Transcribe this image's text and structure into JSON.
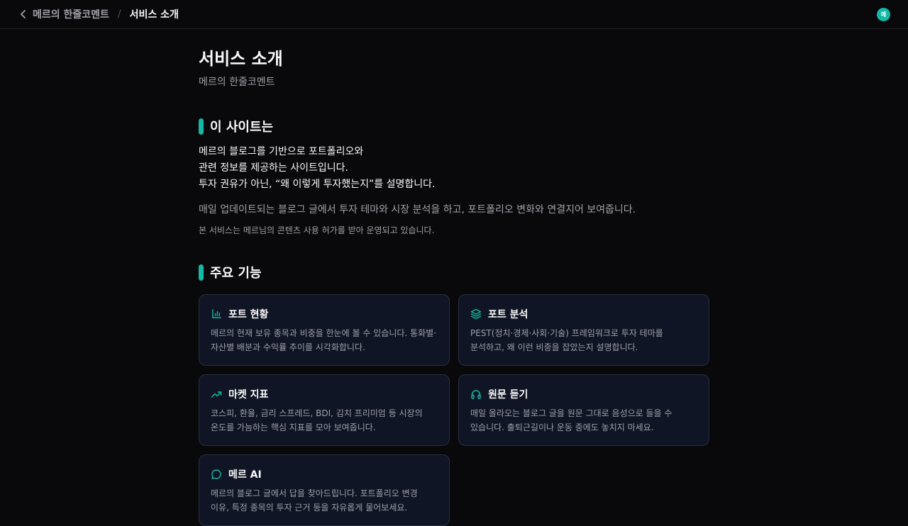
{
  "header": {
    "breadcrumb_parent": "메르의 한줄코멘트",
    "breadcrumb_separator": "/",
    "breadcrumb_current": "서비스 소개",
    "avatar_text": "메"
  },
  "page": {
    "title": "서비스 소개",
    "subtitle": "메르의 한줄코멘트"
  },
  "about": {
    "heading": "이 사이트는",
    "lines": [
      "메르의 블로그를 기반으로 포트폴리오와",
      "관련 정보를 제공하는 사이트입니다.",
      "투자 권유가 아닌, “왜 이렇게 투자했는지”를 설명합니다."
    ],
    "description": "매일 업데이트되는 블로그 글에서 투자 테마와 시장 분석을 하고, 포트폴리오 변화와 연결지어 보여줍니다.",
    "note": "본 서비스는 메르님의 콘텐츠 사용 허가를 받아 운영되고 있습니다."
  },
  "features": {
    "heading": "주요 기능",
    "items": [
      {
        "icon": "bar-chart-icon",
        "title": "포트 현황",
        "desc": "메르의 현재 보유 종목과 비중을 한눈에 볼 수 있습니다. 통화별·자산별 배분과 수익률 추이를 시각화합니다."
      },
      {
        "icon": "layers-icon",
        "title": "포트 분석",
        "desc": "PEST(정치·경제·사회·기술) 프레임워크로 투자 테마를 분석하고, 왜 이런 비중을 잡았는지 설명합니다."
      },
      {
        "icon": "trending-up-icon",
        "title": "마켓 지표",
        "desc": "코스피, 환율, 금리 스프레드, BDI, 김치 프리미엄 등 시장의 온도를 가늠하는 핵심 지표를 모아 보여줍니다."
      },
      {
        "icon": "headphones-icon",
        "title": "원문 듣기",
        "desc": "매일 올라오는 블로그 글을 원문 그대로 음성으로 들을 수 있습니다. 출퇴근길이나 운동 중에도 놓치지 마세요."
      },
      {
        "icon": "chat-bubble-icon",
        "title": "메르 AI",
        "desc": "메르의 블로그 글에서 답을 찾아드립니다. 포트폴리오 변경 이유, 특정 종목의 투자 근거 등을 자유롭게 물어보세요."
      }
    ]
  },
  "colors": {
    "background": "#09090b",
    "accent": "#14b8a6",
    "card_background": "#0f1524",
    "card_border": "#26303f",
    "muted_text": "#a1a1aa"
  }
}
